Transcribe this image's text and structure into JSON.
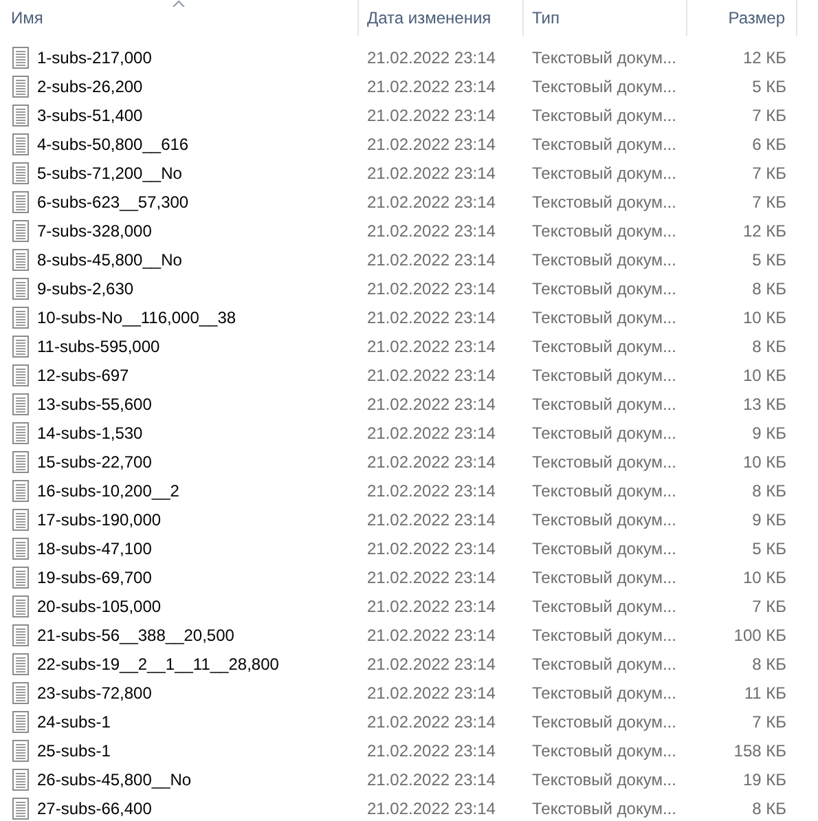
{
  "columns": [
    {
      "label": "Имя",
      "sorted": true
    },
    {
      "label": "Дата изменения",
      "sorted": false
    },
    {
      "label": "Тип",
      "sorted": false
    },
    {
      "label": "Размер",
      "sorted": false
    }
  ],
  "files": [
    {
      "name": "1-subs-217,000",
      "date": "21.02.2022 23:14",
      "type": "Текстовый докум...",
      "size": "12 КБ"
    },
    {
      "name": "2-subs-26,200",
      "date": "21.02.2022 23:14",
      "type": "Текстовый докум...",
      "size": "5 КБ"
    },
    {
      "name": "3-subs-51,400",
      "date": "21.02.2022 23:14",
      "type": "Текстовый докум...",
      "size": "7 КБ"
    },
    {
      "name": "4-subs-50,800__616",
      "date": "21.02.2022 23:14",
      "type": "Текстовый докум...",
      "size": "6 КБ"
    },
    {
      "name": "5-subs-71,200__No",
      "date": "21.02.2022 23:14",
      "type": "Текстовый докум...",
      "size": "7 КБ"
    },
    {
      "name": "6-subs-623__57,300",
      "date": "21.02.2022 23:14",
      "type": "Текстовый докум...",
      "size": "7 КБ"
    },
    {
      "name": "7-subs-328,000",
      "date": "21.02.2022 23:14",
      "type": "Текстовый докум...",
      "size": "12 КБ"
    },
    {
      "name": "8-subs-45,800__No",
      "date": "21.02.2022 23:14",
      "type": "Текстовый докум...",
      "size": "5 КБ"
    },
    {
      "name": "9-subs-2,630",
      "date": "21.02.2022 23:14",
      "type": "Текстовый докум...",
      "size": "8 КБ"
    },
    {
      "name": "10-subs-No__116,000__38",
      "date": "21.02.2022 23:14",
      "type": "Текстовый докум...",
      "size": "10 КБ"
    },
    {
      "name": "11-subs-595,000",
      "date": "21.02.2022 23:14",
      "type": "Текстовый докум...",
      "size": "8 КБ"
    },
    {
      "name": "12-subs-697",
      "date": "21.02.2022 23:14",
      "type": "Текстовый докум...",
      "size": "10 КБ"
    },
    {
      "name": "13-subs-55,600",
      "date": "21.02.2022 23:14",
      "type": "Текстовый докум...",
      "size": "13 КБ"
    },
    {
      "name": "14-subs-1,530",
      "date": "21.02.2022 23:14",
      "type": "Текстовый докум...",
      "size": "9 КБ"
    },
    {
      "name": "15-subs-22,700",
      "date": "21.02.2022 23:14",
      "type": "Текстовый докум...",
      "size": "10 КБ"
    },
    {
      "name": "16-subs-10,200__2",
      "date": "21.02.2022 23:14",
      "type": "Текстовый докум...",
      "size": "8 КБ"
    },
    {
      "name": "17-subs-190,000",
      "date": "21.02.2022 23:14",
      "type": "Текстовый докум...",
      "size": "9 КБ"
    },
    {
      "name": "18-subs-47,100",
      "date": "21.02.2022 23:14",
      "type": "Текстовый докум...",
      "size": "5 КБ"
    },
    {
      "name": "19-subs-69,700",
      "date": "21.02.2022 23:14",
      "type": "Текстовый докум...",
      "size": "10 КБ"
    },
    {
      "name": "20-subs-105,000",
      "date": "21.02.2022 23:14",
      "type": "Текстовый докум...",
      "size": "7 КБ"
    },
    {
      "name": "21-subs-56__388__20,500",
      "date": "21.02.2022 23:14",
      "type": "Текстовый докум...",
      "size": "100 КБ"
    },
    {
      "name": "22-subs-19__2__1__11__28,800",
      "date": "21.02.2022 23:14",
      "type": "Текстовый докум...",
      "size": "8 КБ"
    },
    {
      "name": "23-subs-72,800",
      "date": "21.02.2022 23:14",
      "type": "Текстовый докум...",
      "size": "11 КБ"
    },
    {
      "name": "24-subs-1",
      "date": "21.02.2022 23:14",
      "type": "Текстовый докум...",
      "size": "7 КБ"
    },
    {
      "name": "25-subs-1",
      "date": "21.02.2022 23:14",
      "type": "Текстовый докум...",
      "size": "158 КБ"
    },
    {
      "name": "26-subs-45,800__No",
      "date": "21.02.2022 23:14",
      "type": "Текстовый докум...",
      "size": "19 КБ"
    },
    {
      "name": "27-subs-66,400",
      "date": "21.02.2022 23:14",
      "type": "Текстовый докум...",
      "size": "8 КБ"
    }
  ]
}
